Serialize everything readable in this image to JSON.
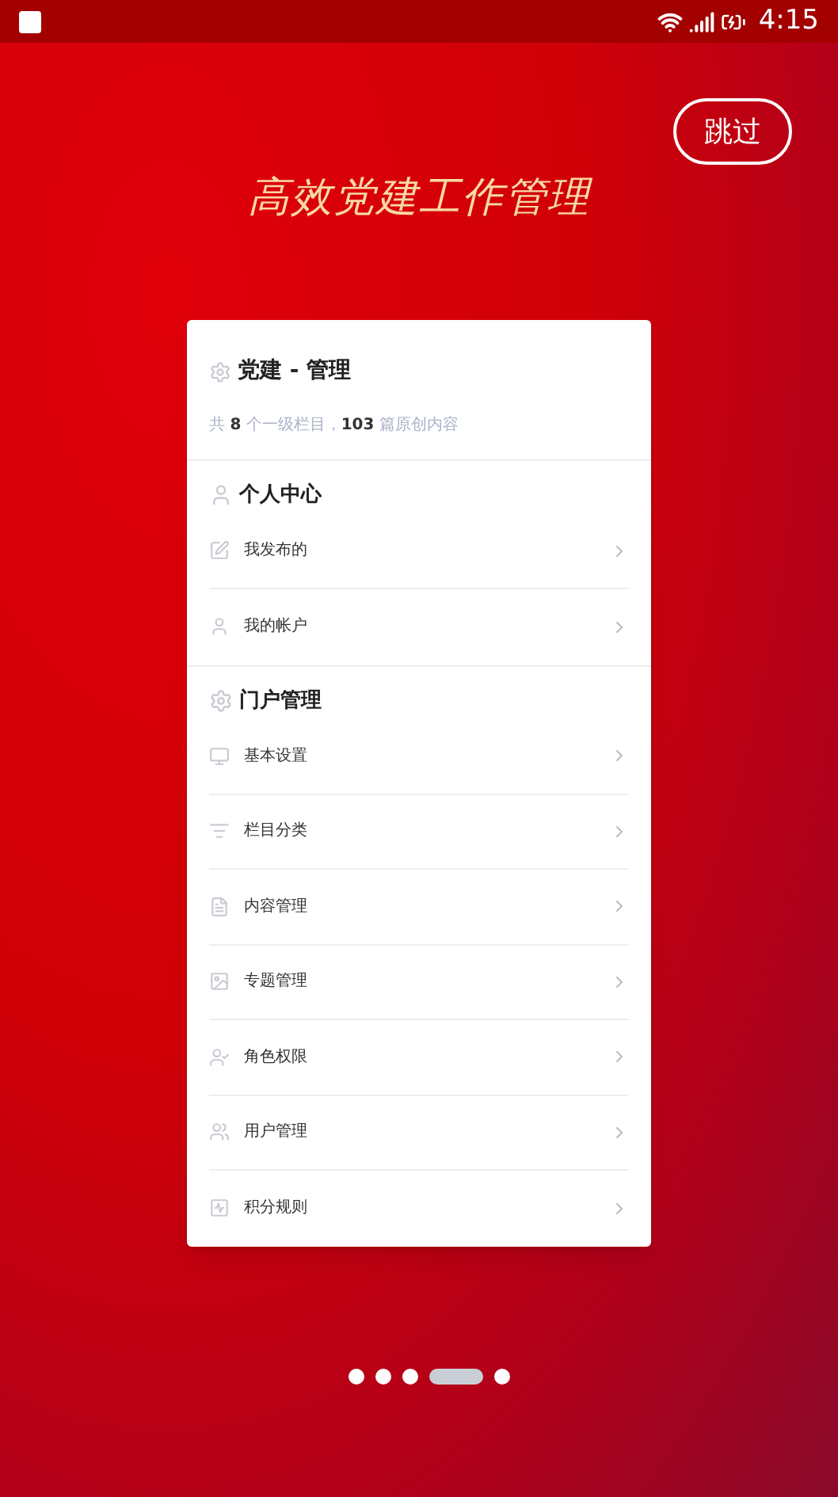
{
  "status_bar": {
    "time": "4:15"
  },
  "skip_button": "跳过",
  "headline": "高效党建工作管理",
  "card": {
    "title": "党建 - 管理",
    "summary": "共 **8** 个一级栏目，**103** 篇原创内容",
    "sections": [
      {
        "title": "个人中心",
        "items": [
          "我发布的",
          "我的帐户"
        ]
      },
      {
        "title": "门户管理",
        "items": [
          "基本设置",
          "栏目分类",
          "内容管理",
          "专题管理",
          "角色权限",
          "用户管理",
          "积分规则"
        ]
      }
    ]
  },
  "pager": [
    {
      "selected": false
    },
    {
      "selected": false
    },
    {
      "selected": false
    },
    {
      "selected": true
    },
    {
      "selected": false
    }
  ]
}
